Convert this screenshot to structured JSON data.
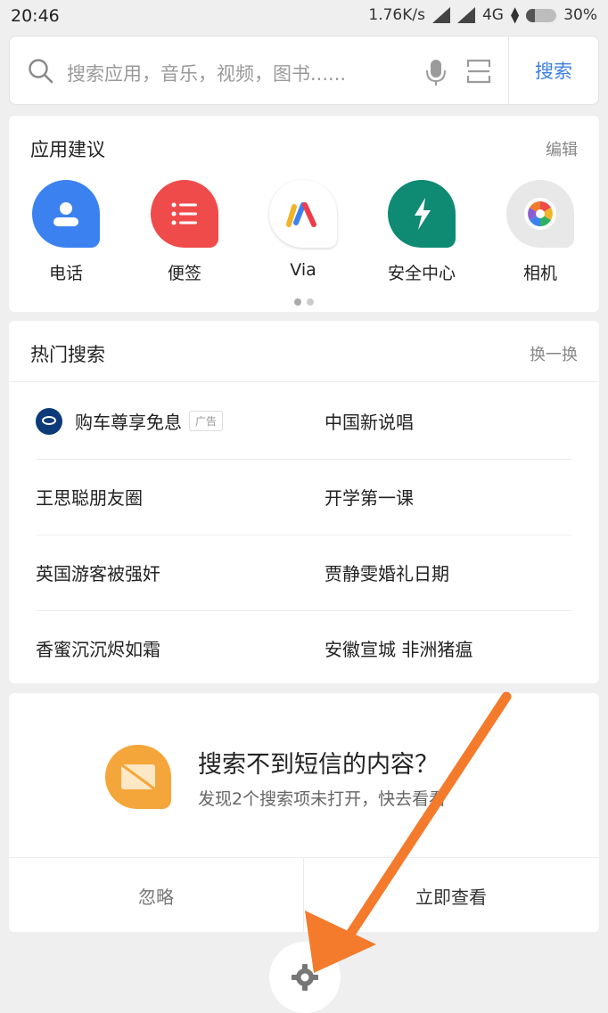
{
  "status_bar": {
    "time": "20:46",
    "speed": "1.76K/s",
    "network": "4G",
    "battery": "30%",
    "battery_level": 0.3
  },
  "search": {
    "placeholder": "搜索应用，音乐，视频，图书......",
    "button_label": "搜索"
  },
  "app_suggestions": {
    "title": "应用建议",
    "action": "编辑",
    "apps": [
      {
        "label": "电话",
        "icon": "phone-icon",
        "color": "#3b82f0"
      },
      {
        "label": "便签",
        "icon": "notes-icon",
        "color": "#ef4b4b"
      },
      {
        "label": "Via",
        "icon": "via-browser-icon",
        "color": "#ffffff"
      },
      {
        "label": "安全中心",
        "icon": "security-center-icon",
        "color": "#0f8a73"
      },
      {
        "label": "相机",
        "icon": "camera-icon",
        "color": "#e8e8e8"
      }
    ],
    "pages": 2,
    "current_page": 1
  },
  "hot_search": {
    "title": "热门搜索",
    "action": "换一换",
    "items": [
      {
        "left": "购车尊享免息",
        "left_ad": "广告",
        "right": "中国新说唱"
      },
      {
        "left": "王思聪朋友圈",
        "right": "开学第一课"
      },
      {
        "left": "英国游客被强奸",
        "right": "贾静雯婚礼日期"
      },
      {
        "left": "香蜜沉沉烬如霜",
        "right": "安徽宣城 非洲猪瘟"
      }
    ]
  },
  "promo": {
    "title": "搜索不到短信的内容？",
    "description": "发现2个搜索项未打开，快去看看",
    "ignore_label": "忽略",
    "view_label": "立即查看",
    "icon": "message-icon",
    "color": "#f5a63a"
  },
  "accent_colors": {
    "link": "#3d7fe0",
    "annotation_arrow": "#f47a2c"
  }
}
